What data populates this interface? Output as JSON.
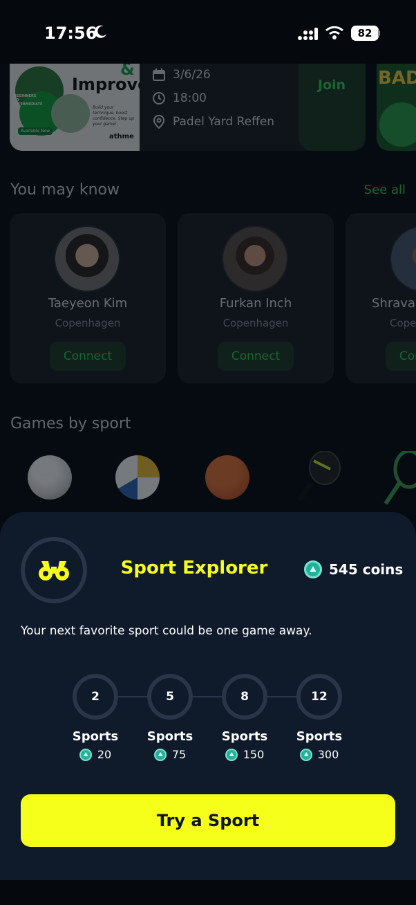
{
  "status_bar": {
    "time": "17:56",
    "battery": "82"
  },
  "event": {
    "image_text": {
      "amp": "&",
      "title": "Improve",
      "caption": "Build your technique, boost confidence. Step up your game!",
      "level": "BEGINNERS TO INTERMEDIATE",
      "badge": "Available Now",
      "brand": "athme"
    },
    "date": "3/6/26",
    "time": "18:00",
    "location": "Padel Yard Reffen",
    "join_label": "Join",
    "next_card_text": "BAD"
  },
  "you_may_know": {
    "title": "You may know",
    "see_all": "See all",
    "people": [
      {
        "name": "Taeyeon Kim",
        "city": "Copenhagen",
        "button": "Connect"
      },
      {
        "name": "Furkan Inch",
        "city": "Copenhagen",
        "button": "Connect"
      },
      {
        "name": "Shravan",
        "city": "Copenhagen",
        "button": "Connect"
      }
    ]
  },
  "games_by_sport": {
    "title": "Games by sport",
    "sports": [
      "football-icon",
      "volleyball-icon",
      "basketball-icon",
      "padel-icon",
      "tennis-icon"
    ]
  },
  "sheet": {
    "title": "Sport Explorer",
    "coins": "545 coins",
    "subtitle": "Your next favorite sport could be one game away.",
    "milestones": [
      {
        "count": "2",
        "label": "Sports",
        "reward": "20"
      },
      {
        "count": "5",
        "label": "Sports",
        "reward": "75"
      },
      {
        "count": "8",
        "label": "Sports",
        "reward": "150"
      },
      {
        "count": "12",
        "label": "Sports",
        "reward": "300"
      }
    ],
    "cta": "Try a Sport"
  },
  "colors": {
    "accent_yellow": "#f6ff1a",
    "accent_green": "#2fd45a",
    "sheet_bg": "#0f1a2b",
    "coin": "#1fb29a"
  }
}
